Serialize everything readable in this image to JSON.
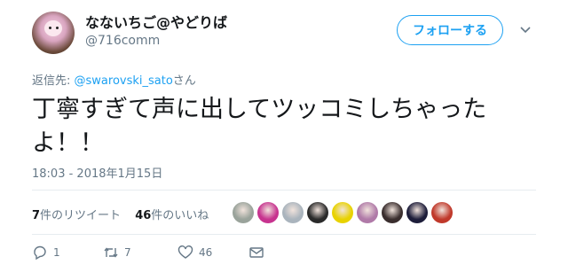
{
  "user": {
    "display_name": "なないちご@やどりば",
    "handle": "@716comm"
  },
  "follow_button_label": "フォローする",
  "reply": {
    "prefix": "返信先: ",
    "mention": "@swarovski_sato",
    "suffix": "さん"
  },
  "tweet_text": "丁寧すぎて声に出してツッコミしちゃったよ！！",
  "timestamp": "18:03 - 2018年1月15日",
  "stats": {
    "retweet_count": "7",
    "retweet_label": "件のリツイート",
    "like_count": "46",
    "like_label": "件のいいね"
  },
  "liker_avatars": [
    {
      "color": "#9aa39b"
    },
    {
      "color": "#c7338f"
    },
    {
      "color": "#aab4bd"
    },
    {
      "color": "#2a2a2a"
    },
    {
      "color": "#e8d200"
    },
    {
      "color": "#b07aa8"
    },
    {
      "color": "#3a2e2e"
    },
    {
      "color": "#1d1d3a"
    },
    {
      "color": "#c0392b"
    }
  ],
  "actions": {
    "reply_count": "1",
    "retweet_count": "7",
    "like_count": "46"
  },
  "colors": {
    "accent": "#1da1f2",
    "text": "#14171a",
    "muted": "#657786",
    "divider": "#e6ecf0"
  },
  "icons": [
    "chevron-down-icon",
    "reply-icon",
    "retweet-icon",
    "heart-icon",
    "mail-icon"
  ]
}
